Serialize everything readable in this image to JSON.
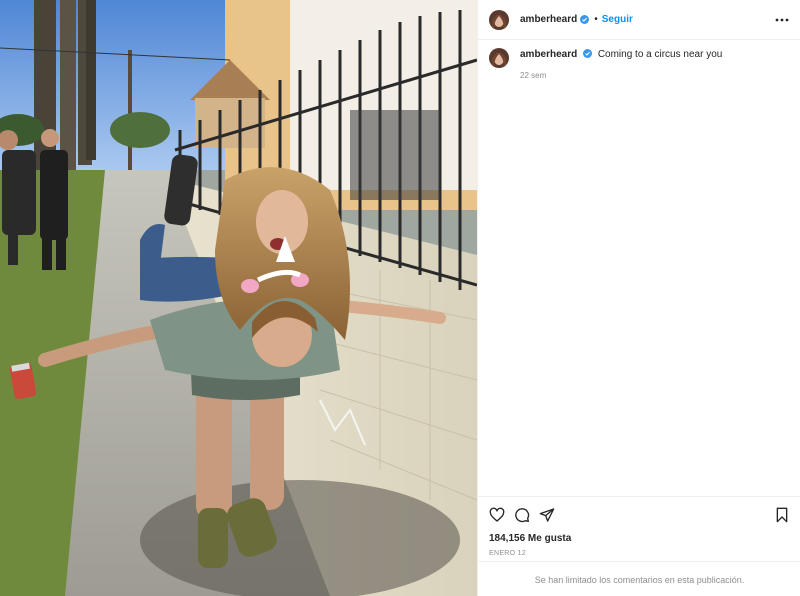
{
  "post": {
    "author": {
      "username": "amberheard",
      "verified": true,
      "avatar_icon": "profile-avatar"
    },
    "header": {
      "separator": "•",
      "follow_label": "Seguir",
      "more_icon": "more-horizontal-icon"
    },
    "caption": {
      "username": "amberheard",
      "text": "Coming to a circus near you",
      "time_ago": "22 sem"
    },
    "actions": {
      "like_icon": "heart-icon",
      "comment_icon": "comment-icon",
      "share_icon": "send-icon",
      "save_icon": "bookmark-icon"
    },
    "likes_text": "184,156 Me gusta",
    "date_text": "ENERO 12",
    "comments_disabled_text": "Se han limitado los comentarios en esta publicación."
  },
  "colors": {
    "link_blue": "#0095f6",
    "verified_blue": "#3897f0",
    "muted_gray": "#8e8e8e",
    "divider": "#efefef"
  }
}
